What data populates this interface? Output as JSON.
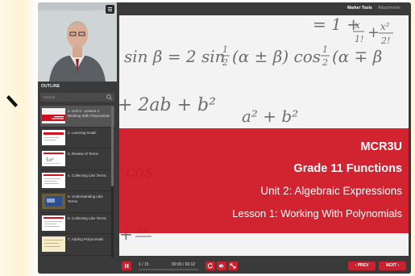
{
  "topbar": {
    "marker_tools": "Marker Tools",
    "attachments": "Attachments"
  },
  "sidebar": {
    "outline_title": "OUTLINE",
    "search_placeholder": "Search...",
    "items": [
      {
        "label": "1. Unit 2 - Lesson 1: Working With Polynomials",
        "active": true
      },
      {
        "label": "2. Learning Goals"
      },
      {
        "label": "3. Review of Terms"
      },
      {
        "label": "4. Collecting Like Terms"
      },
      {
        "label": "5. Understanding Like Terms"
      },
      {
        "label": "6. Collecting Like Terms"
      },
      {
        "label": "7. Adding Polynomials"
      }
    ]
  },
  "slide": {
    "course_code": "MCR3U",
    "course_name": "Grade 11 Functions",
    "unit": "Unit 2: Algebraic Expressions",
    "lesson": "Lesson 1: Working With Polynomials",
    "banner_color": "#ce1220"
  },
  "controls": {
    "slide_counter": "1 / 15",
    "time": "00:00 / 00:12",
    "progress_fraction": 0.0,
    "prev_label": "‹ PREV",
    "next_label": "NEXT ›",
    "accent_color": "#c8212f"
  }
}
